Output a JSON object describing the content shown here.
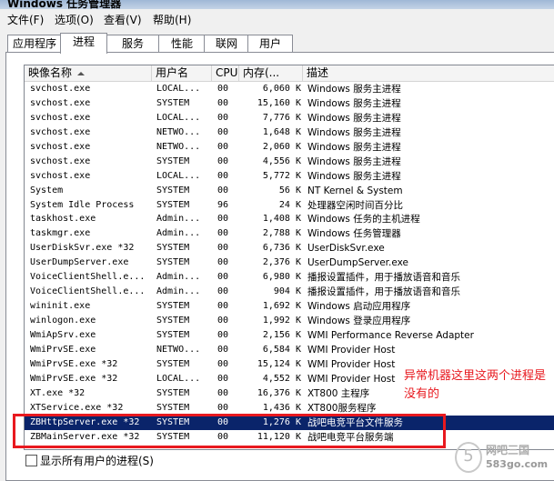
{
  "window": {
    "title": "Windows 任务管理器"
  },
  "menu": [
    "文件(F)",
    "选项(O)",
    "查看(V)",
    "帮助(H)"
  ],
  "tabs": [
    "应用程序",
    "进程",
    "服务",
    "性能",
    "联网",
    "用户"
  ],
  "active_tab": "进程",
  "columns": {
    "name": "映像名称",
    "user": "用户名",
    "cpu": "CPU",
    "mem": "内存(...",
    "desc": "描述"
  },
  "processes": [
    {
      "name": "svchost.exe",
      "user": "LOCAL...",
      "cpu": "00",
      "mem": "6,060 K",
      "desc": "Windows 服务主进程"
    },
    {
      "name": "svchost.exe",
      "user": "SYSTEM",
      "cpu": "00",
      "mem": "15,160 K",
      "desc": "Windows 服务主进程"
    },
    {
      "name": "svchost.exe",
      "user": "LOCAL...",
      "cpu": "00",
      "mem": "7,776 K",
      "desc": "Windows 服务主进程"
    },
    {
      "name": "svchost.exe",
      "user": "NETWO...",
      "cpu": "00",
      "mem": "1,648 K",
      "desc": "Windows 服务主进程"
    },
    {
      "name": "svchost.exe",
      "user": "NETWO...",
      "cpu": "00",
      "mem": "2,060 K",
      "desc": "Windows 服务主进程"
    },
    {
      "name": "svchost.exe",
      "user": "SYSTEM",
      "cpu": "00",
      "mem": "4,556 K",
      "desc": "Windows 服务主进程"
    },
    {
      "name": "svchost.exe",
      "user": "LOCAL...",
      "cpu": "00",
      "mem": "5,772 K",
      "desc": "Windows 服务主进程"
    },
    {
      "name": "System",
      "user": "SYSTEM",
      "cpu": "00",
      "mem": "56 K",
      "desc": "NT Kernel & System"
    },
    {
      "name": "System Idle Process",
      "user": "SYSTEM",
      "cpu": "96",
      "mem": "24 K",
      "desc": "处理器空闲时间百分比"
    },
    {
      "name": "taskhost.exe",
      "user": "Admin...",
      "cpu": "00",
      "mem": "1,408 K",
      "desc": "Windows 任务的主机进程"
    },
    {
      "name": "taskmgr.exe",
      "user": "Admin...",
      "cpu": "00",
      "mem": "2,788 K",
      "desc": "Windows 任务管理器"
    },
    {
      "name": "UserDiskSvr.exe *32",
      "user": "SYSTEM",
      "cpu": "00",
      "mem": "6,736 K",
      "desc": "UserDiskSvr.exe"
    },
    {
      "name": "UserDumpServer.exe",
      "user": "SYSTEM",
      "cpu": "00",
      "mem": "2,376 K",
      "desc": "UserDumpServer.exe"
    },
    {
      "name": "VoiceClientShell.e...",
      "user": "Admin...",
      "cpu": "00",
      "mem": "6,980 K",
      "desc": "播报设置插件，用于播放语音和音乐"
    },
    {
      "name": "VoiceClientShell.e...",
      "user": "Admin...",
      "cpu": "00",
      "mem": "904 K",
      "desc": "播报设置插件，用于播放语音和音乐"
    },
    {
      "name": "wininit.exe",
      "user": "SYSTEM",
      "cpu": "00",
      "mem": "1,692 K",
      "desc": "Windows 启动应用程序"
    },
    {
      "name": "winlogon.exe",
      "user": "SYSTEM",
      "cpu": "00",
      "mem": "1,992 K",
      "desc": "Windows 登录应用程序"
    },
    {
      "name": "WmiApSrv.exe",
      "user": "SYSTEM",
      "cpu": "00",
      "mem": "2,156 K",
      "desc": "WMI Performance Reverse Adapter"
    },
    {
      "name": "WmiPrvSE.exe",
      "user": "NETWO...",
      "cpu": "00",
      "mem": "6,584 K",
      "desc": "WMI Provider Host"
    },
    {
      "name": "WmiPrvSE.exe *32",
      "user": "SYSTEM",
      "cpu": "00",
      "mem": "15,124 K",
      "desc": "WMI Provider Host"
    },
    {
      "name": "WmiPrvSE.exe *32",
      "user": "LOCAL...",
      "cpu": "00",
      "mem": "4,552 K",
      "desc": "WMI Provider Host"
    },
    {
      "name": "XT.exe *32",
      "user": "SYSTEM",
      "cpu": "00",
      "mem": "16,376 K",
      "desc": "XT800 主程序"
    },
    {
      "name": "XTService.exe *32",
      "user": "SYSTEM",
      "cpu": "00",
      "mem": "1,436 K",
      "desc": "XT800服务程序"
    },
    {
      "name": "ZBHttpServer.exe *32",
      "user": "SYSTEM",
      "cpu": "00",
      "mem": "1,276 K",
      "desc": "战吧电竞平台文件服务",
      "selected": true
    },
    {
      "name": "ZBMainServer.exe *32",
      "user": "SYSTEM",
      "cpu": "00",
      "mem": "11,120 K",
      "desc": "战吧电竞平台服务端"
    }
  ],
  "annotation": "异常机器这里这两个进程是没有的",
  "show_all_users": "显示所有用户的进程(S)",
  "watermark": {
    "site": "网吧三国",
    "url": "583go.com"
  },
  "colors": {
    "annotation": "#e8191f",
    "selection": "#0a246a"
  }
}
